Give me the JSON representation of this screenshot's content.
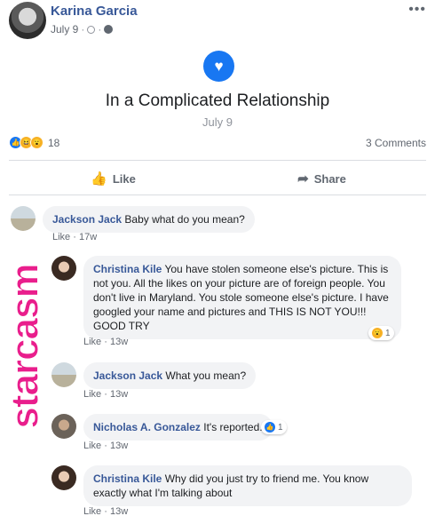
{
  "post": {
    "author": "Karina Garcia",
    "date": "July 9",
    "meta_sep": "·",
    "more_label": "•••",
    "event_icon": "heart-icon",
    "event_title": "In a Complicated Relationship",
    "event_date": "July 9",
    "reaction_count": "18",
    "comments_count": "3 Comments"
  },
  "actions": {
    "like_label": "Like",
    "share_label": "Share"
  },
  "colors": {
    "link": "#385898",
    "accent": "#1877f2",
    "watermark": "#e91e8c"
  },
  "comments": [
    {
      "name": "Jackson Jack",
      "text": "Baby what do you mean?",
      "like": "Like",
      "time": "17w"
    },
    {
      "name": "Christina Kile",
      "text": "You have stolen someone else's picture. This is not you. All the likes on your picture are of foreign people. You don't live in Maryland. You stole someone else's picture. I have googled your name and pictures and THIS IS NOT YOU!!! GOOD TRY",
      "like": "Like",
      "time": "13w",
      "reaction_count": "1"
    },
    {
      "name": "Jackson Jack",
      "text": "What you mean?",
      "like": "Like",
      "time": "13w"
    },
    {
      "name": "Nicholas A. Gonzalez",
      "text": "It's reported.",
      "like": "Like",
      "time": "13w",
      "reaction_count": "1"
    },
    {
      "name": "Christina Kile",
      "text": "Why did you just try to friend me. You know exactly what I'm talking about",
      "like": "Like",
      "time": "13w"
    }
  ],
  "watermark": "starcasm"
}
